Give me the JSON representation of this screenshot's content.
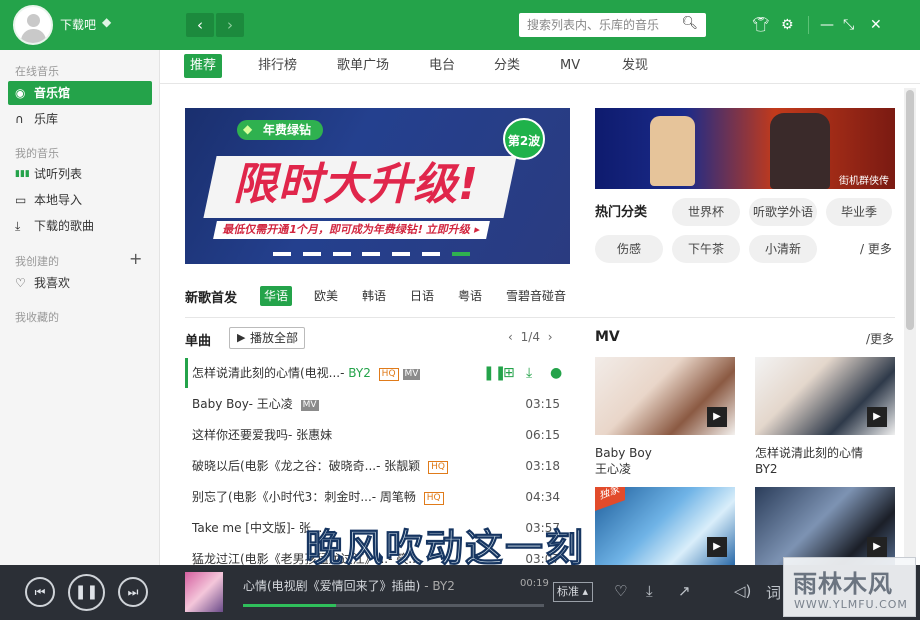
{
  "header": {
    "username": "下载吧",
    "search_placeholder": "搜索列表内、乐库的音乐"
  },
  "sidebar": {
    "groups": [
      "在线音乐",
      "我的音乐",
      "我创建的",
      "我收藏的"
    ],
    "items": [
      {
        "label": "音乐馆",
        "icon": "disc-icon",
        "active": true
      },
      {
        "label": "乐库",
        "icon": "headphones-icon"
      },
      {
        "label": "试听列表",
        "icon": "equalizer-icon"
      },
      {
        "label": "本地导入",
        "icon": "monitor-icon"
      },
      {
        "label": "下载的歌曲",
        "icon": "download-icon"
      },
      {
        "label": "我喜欢",
        "icon": "heart-icon"
      }
    ]
  },
  "tabs": [
    "推荐",
    "排行榜",
    "歌单广场",
    "电台",
    "分类",
    "MV",
    "发现"
  ],
  "banner": {
    "tag": "年费绿钻",
    "headline": "限时大升级!",
    "badge": "第2波",
    "subline": "最低仅需开通1个月，即可成为年费绿钻! 立即升级 ▸"
  },
  "thumb_caption": "街机群侠传",
  "hot": {
    "title": "热门分类",
    "tags": [
      "世界杯",
      "听歌学外语",
      "毕业季",
      "伤感",
      "下午茶",
      "小清新"
    ],
    "more": "/ 更多"
  },
  "new_songs": {
    "title": "新歌首发",
    "regions": [
      "华语",
      "欧美",
      "韩语",
      "日语",
      "粤语",
      "雪碧音碰音"
    ],
    "single_title": "单曲",
    "play_all": "播放全部",
    "page": "1/4"
  },
  "songs": [
    {
      "title": "怎样说清此刻的心情(电视...",
      "artist": "BY2",
      "tags": [
        "hq",
        "mv"
      ],
      "duration": ""
    },
    {
      "title": "Baby Boy",
      "artist": "王心凌",
      "tags": [
        "mv"
      ],
      "duration": "03:15"
    },
    {
      "title": "这样你还要爱我吗",
      "artist": "张惠妹",
      "tags": [],
      "duration": "06:15"
    },
    {
      "title": "破晓以后(电影《龙之谷：破晓奇...",
      "artist": "张靓颖",
      "tags": [
        "hq"
      ],
      "duration": "03:18"
    },
    {
      "title": "别忘了(电影《小时代3：刺金时...",
      "artist": "周笔畅",
      "tags": [
        "hq"
      ],
      "duration": "04:34"
    },
    {
      "title": "Take me [中文版]",
      "artist": "张...",
      "tags": [],
      "duration": "03:57"
    },
    {
      "title": "猛龙过江(电影《老男孩猛龙过江》...",
      "artist": "筷...",
      "tags": [],
      "duration": "03:07"
    }
  ],
  "tag_labels": {
    "hq": "HQ",
    "mv": "MV"
  },
  "mv": {
    "title": "MV",
    "more": "/更多",
    "cards": [
      {
        "title": "Baby Boy",
        "artist": "王心凌"
      },
      {
        "title": "怎样说清此刻的心情",
        "artist": "BY2"
      },
      {
        "title": "",
        "artist": "",
        "badge": "独家"
      },
      {
        "title": "",
        "artist": ""
      }
    ]
  },
  "lyric_overlay": "晚风吹动这一刻",
  "player": {
    "track": "心情(电视剧《爱情回来了》插曲)",
    "artist": "BY2",
    "time": "00:19",
    "progress": 0.31,
    "quality": "标准"
  },
  "watermark": {
    "logo": "雨林木风",
    "url": "WWW.YLMFU.COM"
  },
  "colors": {
    "accent": "#24a34a",
    "player_bg": "#2b2f36"
  }
}
